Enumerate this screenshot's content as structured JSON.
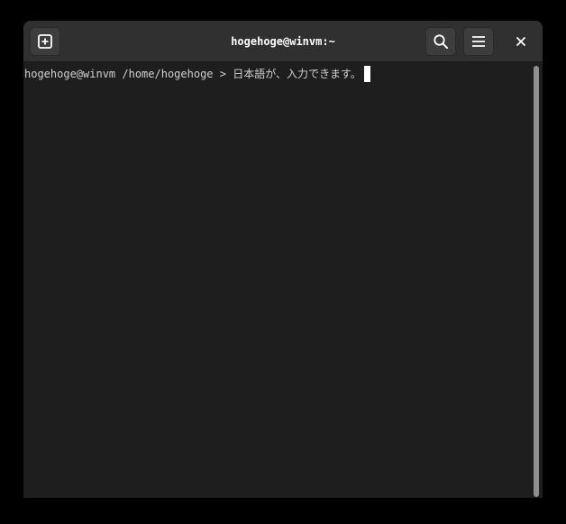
{
  "window": {
    "title": "hogehoge@winvm:~"
  },
  "headerbar": {
    "new_tab_icon": "new-tab-icon",
    "search_icon": "search-icon",
    "menu_icon": "hamburger-menu-icon",
    "close_icon": "close-icon"
  },
  "terminal": {
    "prompt": "hogehoge@winvm /home/hogehoge > ",
    "input": "日本語が、入力できます。"
  },
  "colors": {
    "headerbar_bg": "#303030",
    "terminal_bg": "#1e1e1e",
    "text": "#d0d0d0",
    "cursor": "#ffffff"
  }
}
